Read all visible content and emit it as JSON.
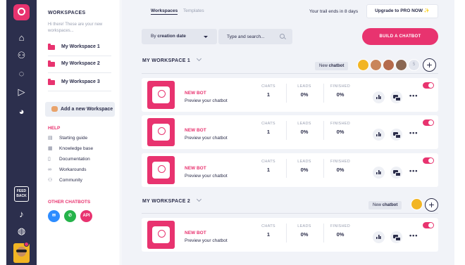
{
  "colors": {
    "accent": "#e8336f",
    "rail": "#2c2f4d",
    "main_bg": "#f1f3f8"
  },
  "rail": {
    "icons": [
      "home-icon",
      "users-icon",
      "chat-bubble-icon",
      "broadcast-icon",
      "pie-chart-icon",
      "bell-icon",
      "globe-icon"
    ],
    "feedback_label": "FEED BACK"
  },
  "panel": {
    "title": "WORKSPACES",
    "hint": "Hi there! These are your new workspaces...",
    "workspaces": [
      "My Workspace 1",
      "My Workspace 2",
      "My Workspace 3"
    ],
    "add_label": "Add a new Workspace",
    "help_title": "HELP",
    "help_items": [
      {
        "label": "Starting guide",
        "icon": "book-icon"
      },
      {
        "label": "Knowledge base",
        "icon": "grid-icon"
      },
      {
        "label": "Documentation",
        "icon": "document-icon"
      },
      {
        "label": "Workarounds",
        "icon": "link-icon"
      },
      {
        "label": "Community",
        "icon": "people-icon"
      }
    ],
    "other_title": "OTHER CHATBOTS",
    "other_api": "API"
  },
  "topbar": {
    "tabs": [
      "Workspaces",
      "Templates"
    ],
    "trail": "Your trail ends in 8 days",
    "upgrade": "Upgrade to PRO NOW ✨"
  },
  "toolbar": {
    "sort_prefix": "By ",
    "sort_value": "creation date",
    "search_placeholder": "Type and search...",
    "build_label": "BUILD A CHATBOT"
  },
  "sections": [
    {
      "title": "MY WORKSPACE 1",
      "new_prefix": "New ",
      "new_bold": "chatbot",
      "member_badge": "5",
      "bots": [
        {
          "name": "NEW BOT",
          "sub": "Preview your chatbot",
          "chats": "1",
          "leads": "0%",
          "finished": "0%"
        },
        {
          "name": "NEW BOT",
          "sub": "Preview your chatbot",
          "chats": "1",
          "leads": "0%",
          "finished": "0%"
        },
        {
          "name": "NEW BOT",
          "sub": "Preview your chatbot",
          "chats": "1",
          "leads": "0%",
          "finished": "0%"
        }
      ]
    },
    {
      "title": "MY WORKSPACE 2",
      "new_prefix": "New ",
      "new_bold": "chatbot",
      "bots": [
        {
          "name": "NEW BOT",
          "sub": "Preview your chatbot",
          "chats": "1",
          "leads": "0%",
          "finished": "0%"
        }
      ]
    }
  ],
  "stat_labels": {
    "chats": "CHATS",
    "leads": "LEADS",
    "finished": "FINISHED"
  },
  "more_label": "•••"
}
